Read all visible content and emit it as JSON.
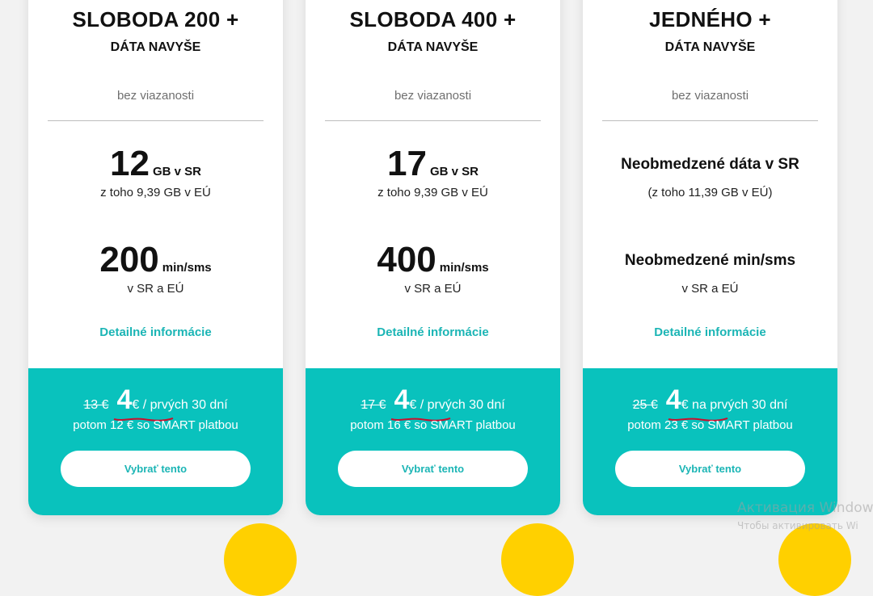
{
  "plans": [
    {
      "title": "SLOBODA 200 +",
      "subtitle": "DÁTA NAVYŠE",
      "commitment": "bez viazanosti",
      "data_amount": "12",
      "data_unit": "GB v SR",
      "data_sub": "z toho 9,39 GB v EÚ",
      "minutes_amount": "200",
      "minutes_unit": "min/sms",
      "minutes_sub": "v SR a EÚ",
      "detail_link": "Detailné informácie",
      "old_price": "13 €",
      "new_price": "4",
      "price_suffix": "€ / prvých 30 dní",
      "after_price": "potom 12 € so SMART platbou",
      "button": "Vybrať tento"
    },
    {
      "title": "SLOBODA 400 +",
      "subtitle": "DÁTA NAVYŠE",
      "commitment": "bez viazanosti",
      "data_amount": "17",
      "data_unit": "GB v SR",
      "data_sub": "z toho 9,39 GB v EÚ",
      "minutes_amount": "400",
      "minutes_unit": "min/sms",
      "minutes_sub": "v SR a EÚ",
      "detail_link": "Detailné informácie",
      "old_price": "17 €",
      "new_price": "4",
      "price_suffix": "€ / prvých 30 dní",
      "after_price": "potom 16 € so SMART platbou",
      "button": "Vybrať tento"
    },
    {
      "title": "JEDNÉHO +",
      "subtitle": "DÁTA NAVYŠE",
      "commitment": "bez viazanosti",
      "data_text": "Neobmedzené dáta v SR",
      "data_sub": "(z toho 11,39 GB v EÚ)",
      "minutes_text": "Neobmedzené min/sms",
      "minutes_sub": "v SR a EÚ",
      "detail_link": "Detailné informácie",
      "old_price": "25 €",
      "new_price": "4",
      "price_suffix": "€ na prvých 30 dní",
      "after_price": "potom 23 € so SMART platbou",
      "button": "Vybrať tento"
    }
  ],
  "watermark": {
    "line1": "Активация Window",
    "line2": "Чтобы активировать Wi"
  },
  "colors": {
    "accent": "#09c2bd",
    "link": "#1bb5b5",
    "annotation": "#c8102e",
    "yellow": "#ffd000"
  }
}
